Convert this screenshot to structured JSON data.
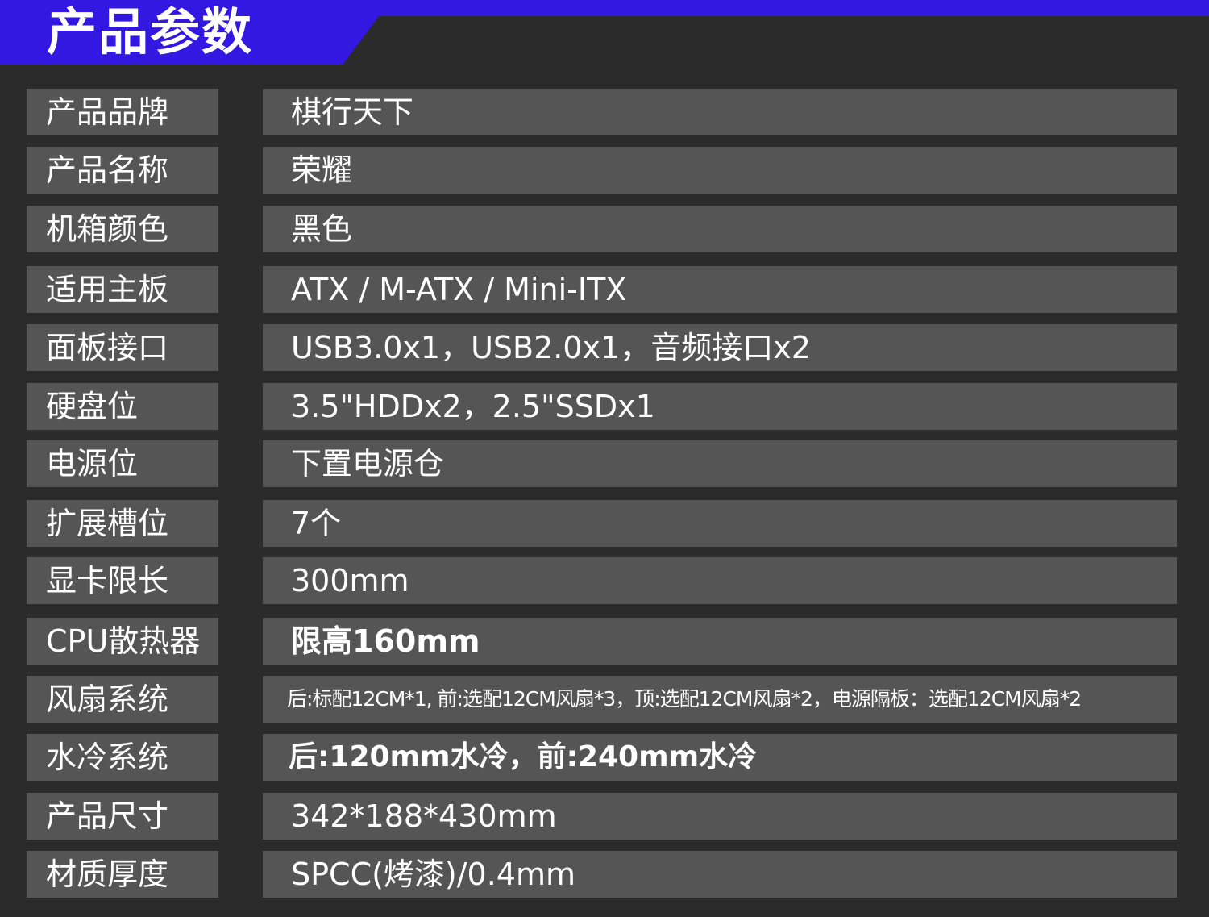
{
  "title": "产品参数",
  "specs": [
    {
      "label": "产品品牌",
      "value": "棋行天下"
    },
    {
      "label": "产品名称",
      "value": "荣耀"
    },
    {
      "label": "机箱颜色",
      "value": "黑色"
    },
    {
      "label": "适用主板",
      "value": "ATX / M-ATX / Mini-ITX"
    },
    {
      "label": "面板接口",
      "value": "USB3.0x1，USB2.0x1，音频接口x2"
    },
    {
      "label": "硬盘位",
      "value": "3.5\"HDDx2，2.5\"SSDx1"
    },
    {
      "label": "电源位",
      "value": "下置电源仓"
    },
    {
      "label": "扩展槽位",
      "value": "7个"
    },
    {
      "label": "显卡限长",
      "value": "300mm"
    },
    {
      "label": "CPU散热器",
      "value": "限高160mm"
    },
    {
      "label": "风扇系统",
      "value": "后:标配12CM*1, 前:选配12CM风扇*3，顶:选配12CM风扇*2，电源隔板：选配12CM风扇*2"
    },
    {
      "label": "水冷系统",
      "value": "后:120mm水冷，前:240mm水冷"
    },
    {
      "label": "产品尺寸",
      "value": "342*188*430mm"
    },
    {
      "label": "材质厚度",
      "value": "SPCC(烤漆)/0.4mm"
    }
  ]
}
